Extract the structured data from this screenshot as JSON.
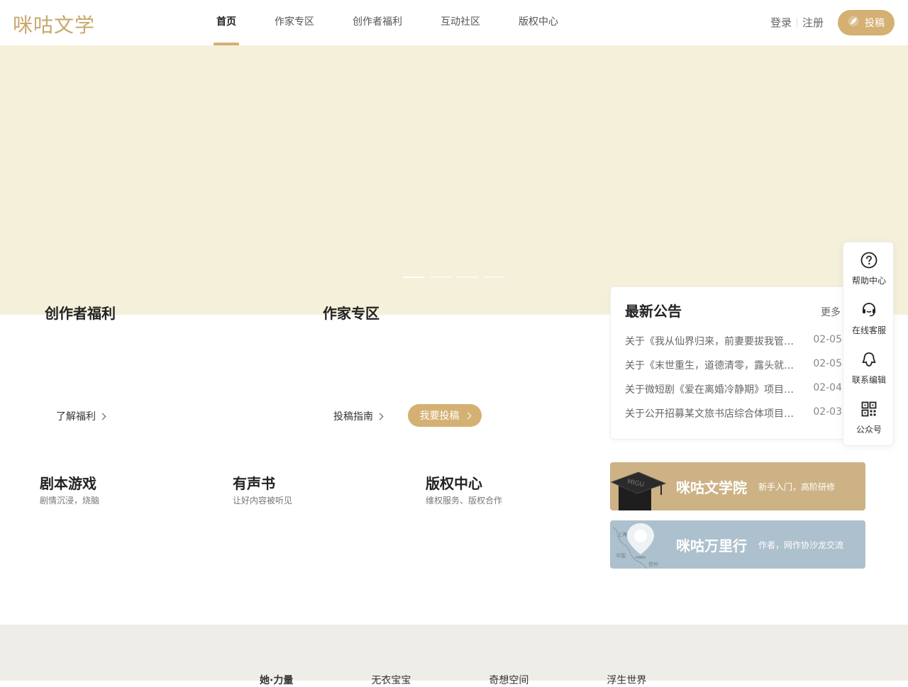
{
  "header": {
    "logo": "咪咕文学",
    "nav": [
      "首页",
      "作家专区",
      "创作者福利",
      "互动社区",
      "版权中心"
    ],
    "active_nav": "首页",
    "login": "登录",
    "register": "注册",
    "submit": "投稿"
  },
  "banner": {
    "slides": 4,
    "active_slide": 1
  },
  "welfare": {
    "title": "创作者福利",
    "link": "了解福利"
  },
  "writer": {
    "title": "作家专区",
    "guide": "投稿指南",
    "submit_btn": "我要投稿"
  },
  "notice": {
    "title": "最新公告",
    "more": "更多",
    "items": [
      {
        "text": "关于《我从仙界归来，前妻要拔我管…",
        "date": "02-05"
      },
      {
        "text": "关于《末世重生，道德清零，露头就…",
        "date": "02-05"
      },
      {
        "text": "关于微短剧《爱在离婚冷静期》项目…",
        "date": "02-04"
      },
      {
        "text": "关于公开招募某文旅书店综合体项目…",
        "date": "02-03"
      }
    ]
  },
  "sidebar": [
    {
      "label": "帮助中心",
      "icon": "question-icon"
    },
    {
      "label": "在线客服",
      "icon": "headset-icon"
    },
    {
      "label": "联系编辑",
      "icon": "chat-bubble-icon"
    },
    {
      "label": "公众号",
      "icon": "qr-code-icon"
    }
  ],
  "features": [
    {
      "title": "剧本游戏",
      "sub": "剧情沉浸，烧脑"
    },
    {
      "title": "有声书",
      "sub": "让好内容被听见"
    },
    {
      "title": "版权中心",
      "sub": "维权服务、版权合作"
    }
  ],
  "promos": [
    {
      "title": "咪咕文学院",
      "sub": "新手入门，高阶研修",
      "color": "#cdb285",
      "cap_text": "MIGU"
    },
    {
      "title": "咪咕万里行",
      "sub": "作者，网作协沙龙交流",
      "color": "#adc0cd",
      "map_labels": [
        "上海",
        "中国",
        "信州"
      ]
    }
  ],
  "footer": {
    "tabs": [
      "她·力量",
      "无衣宝宝",
      "奇想空间",
      "浮生世界"
    ],
    "active_tab": "她·力量"
  },
  "colors": {
    "accent": "#d4b073",
    "banner": "#f5f0da",
    "footer": "#efede8"
  }
}
